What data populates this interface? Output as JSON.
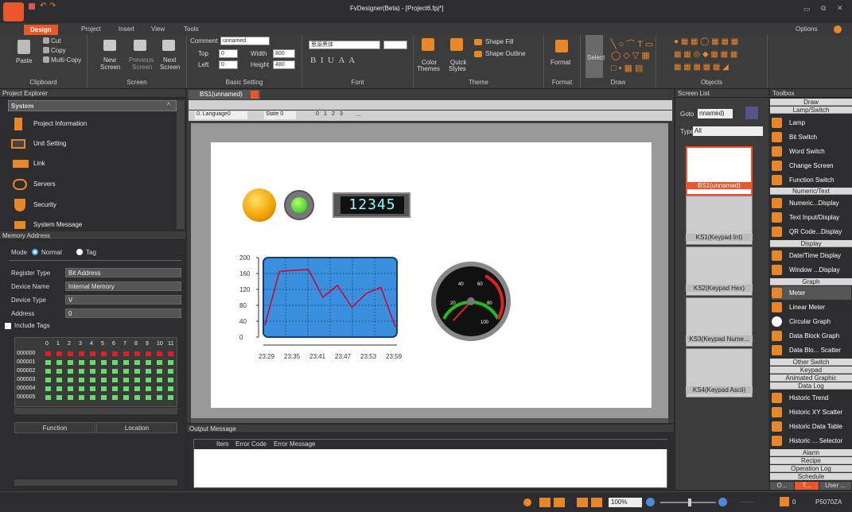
{
  "window": {
    "title": "FvDesigner(Beta) - [Project6.fpj*]"
  },
  "tabs": [
    "Design",
    "Project",
    "Insert",
    "View",
    "Tools"
  ],
  "options": "Options",
  "ribbon": {
    "clipboard": {
      "paste": "Paste",
      "cut": "Cut",
      "copy": "Copy",
      "multicopy": "Multi-Copy",
      "label": "Clipboard"
    },
    "screen": {
      "new": "New",
      "new2": "Screen",
      "previous": "Previous",
      "previous2": "Screen",
      "next": "Next",
      "next2": "Screen",
      "label": "Screen"
    },
    "basic": {
      "comment": "Comment",
      "comment_val": "unnamed",
      "top": "Top",
      "top_val": "0",
      "left": "Left",
      "left_val": "0",
      "width": "Width",
      "width_val": "800",
      "height": "Height",
      "height_val": "480",
      "label": "Basic Setting"
    },
    "font": {
      "name": "思源黑体",
      "label": "Font"
    },
    "theme": {
      "color": "Color",
      "color2": "Themes",
      "quick": "Quick",
      "quick2": "Styles",
      "fill": "Shape Fill",
      "outline": "Shape Outline",
      "label": "Theme"
    },
    "format": {
      "btn": "Format",
      "label": "Format"
    },
    "draw": {
      "select": "Select",
      "label": "Draw"
    },
    "objects": {
      "label": "Objects"
    }
  },
  "project_explorer": {
    "title": "Project Explorer",
    "section": "System",
    "items": [
      "Project Information",
      "Unit Setting",
      "Link",
      "Servers",
      "Security",
      "System Message"
    ]
  },
  "memory": {
    "title": "Memory Address",
    "mode": "Mode",
    "normal": "Normal",
    "tag": "Tag",
    "register_type": "Register Type",
    "register_val": "Bit Address",
    "device_name": "Device Name",
    "device_name_val": "Internal Memory",
    "device_type": "Device Type",
    "device_type_val": "V",
    "address": "Address",
    "address_val": "0",
    "include_tags": "Include Tags",
    "cols": [
      "0",
      "1",
      "2",
      "3",
      "4",
      "5",
      "6",
      "7",
      "8",
      "9",
      "10",
      "11"
    ],
    "rows": [
      "000000",
      "000001",
      "000002",
      "000003",
      "000004",
      "000005"
    ],
    "func_col": "Function",
    "loc_col": "Location"
  },
  "editor": {
    "tab": "BS1(unnamed)",
    "language": "0. Language0",
    "state": "State 0",
    "nums": [
      "0",
      "1",
      "2",
      "3"
    ],
    "more": "...",
    "numeric": "12345",
    "chart_ylabels": [
      "200",
      "160",
      "120",
      "80",
      "40",
      "0"
    ],
    "chart_xlabels": [
      "23:29",
      "23:35",
      "23:41",
      "23:47",
      "23:53",
      "23:59"
    ],
    "meter_labels": [
      "20",
      "40",
      "60",
      "80",
      "100"
    ]
  },
  "output": {
    "title": "Output Message",
    "cols": [
      "Item",
      "Error Code",
      "Error Message"
    ]
  },
  "screen_list": {
    "title": "Screen List",
    "goto": "Goto",
    "goto_val": "nnamed)",
    "type": "Type",
    "type_val": "All",
    "screens": [
      "BS1(unnamed)",
      "KS1(Keypad Int)",
      "KS2(Keypad Hex)",
      "KS3(Keypad Nume...",
      "KS4(Keypad Ascii)"
    ]
  },
  "toolbox": {
    "title": "Toolbox",
    "cat_draw": "Draw",
    "cat_lamp": "Lamp/Switch",
    "lamp_items": [
      "Lamp",
      "Bit Switch",
      "Word Switch",
      "Change Screen",
      "Function Switch"
    ],
    "cat_numeric": "Numeric/Text",
    "numeric_items": [
      "Numeric...Display",
      "Text Input/Display",
      "QR Code...Display"
    ],
    "cat_display": "Display",
    "display_items": [
      "Date/Time Display",
      "Window ...Display"
    ],
    "cat_graph": "Graph",
    "graph_items": [
      "Meter",
      "Linear Meter",
      "Circular Graph",
      "Data Block Graph",
      "Data Blo... Scatter"
    ],
    "cat_other": "Other Switch",
    "cat_keypad": "Keypad",
    "cat_anim": "Animated Graphic",
    "cat_datalog": "Data Log",
    "datalog_items": [
      "Historic Trend",
      "Historic XY Scatter",
      "Historic Data Table",
      "Historic ... Selector"
    ],
    "cat_alarm": "Alarm",
    "cat_recipe": "Recipe",
    "cat_oplog": "Operation Log",
    "cat_schedule": "Schedule",
    "bottom_tabs": [
      "O...",
      "T...",
      "User ..."
    ]
  },
  "status": {
    "zoom": "100%",
    "dots": "........",
    "count": "0",
    "model": "P5070ZA"
  },
  "trend": {
    "values": [
      30,
      165,
      168,
      170,
      100,
      130,
      75,
      110,
      125,
      25
    ]
  }
}
